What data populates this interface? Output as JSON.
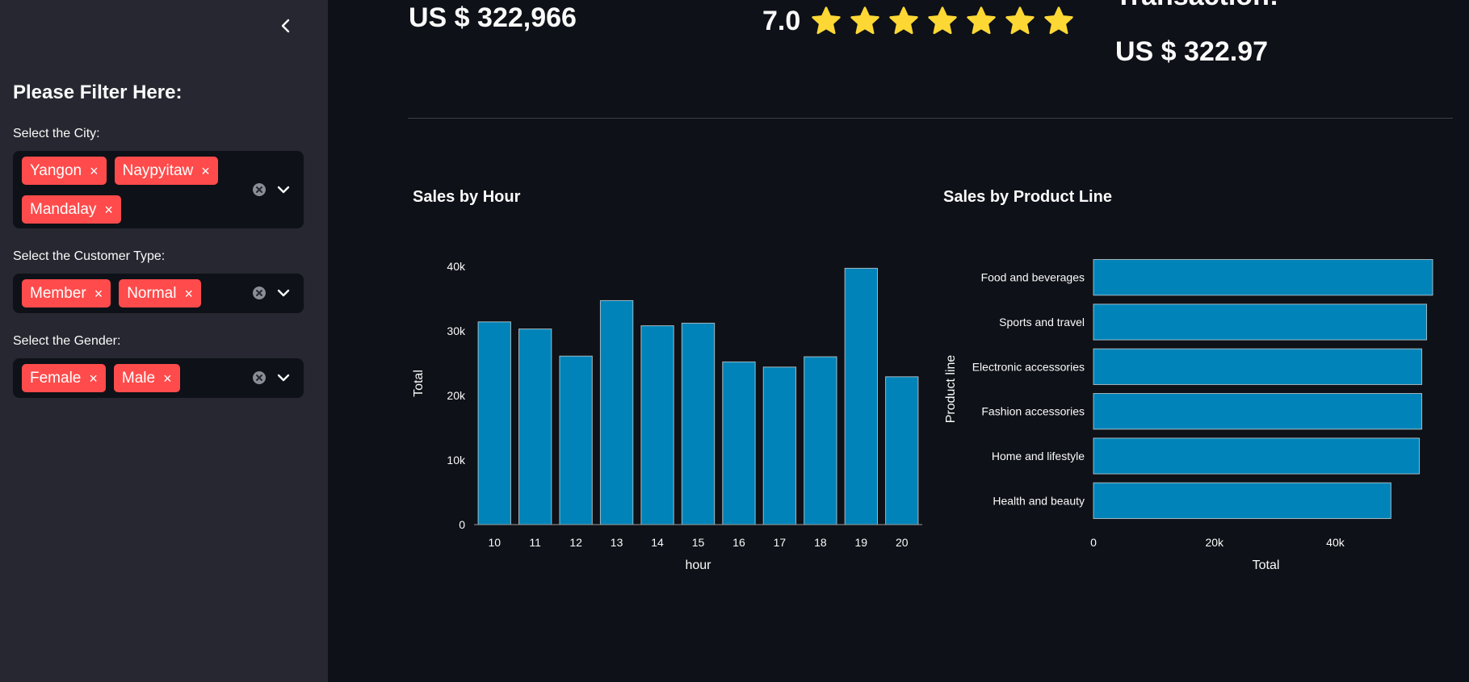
{
  "sidebar": {
    "title": "Please Filter Here:",
    "filters": [
      {
        "label": "Select the City:",
        "tags": [
          "Yangon",
          "Naypyitaw",
          "Mandalay"
        ]
      },
      {
        "label": "Select the Customer Type:",
        "tags": [
          "Member",
          "Normal"
        ]
      },
      {
        "label": "Select the Gender:",
        "tags": [
          "Female",
          "Male"
        ]
      }
    ],
    "tag_close_glyph": "×"
  },
  "kpis": {
    "total_sales": "US $ 322,966",
    "rating": "7.0",
    "rating_stars": 7,
    "avg_transaction_heading": "Transaction:",
    "avg_transaction": "US $ 322.97"
  },
  "colors": {
    "bar": "#0083b8",
    "tag": "#ff4b4b",
    "star": "#fdd835",
    "sidebar_bg": "#262730",
    "main_bg": "#0e1117"
  },
  "chart_data": [
    {
      "type": "bar",
      "title": "Sales by Hour",
      "xlabel": "hour",
      "ylabel": "Total",
      "categories": [
        "10",
        "11",
        "12",
        "13",
        "14",
        "15",
        "16",
        "17",
        "18",
        "19",
        "20"
      ],
      "values": [
        31400,
        30300,
        26100,
        34700,
        30800,
        31200,
        25200,
        24400,
        26000,
        39700,
        22900
      ],
      "ylim": [
        0,
        41000
      ],
      "yticks": [
        0,
        10000,
        20000,
        30000,
        40000
      ],
      "ytick_labels": [
        "0",
        "10k",
        "20k",
        "30k",
        "40k"
      ],
      "grid": false
    },
    {
      "type": "bar",
      "orientation": "horizontal",
      "title": "Sales by Product Line",
      "xlabel": "Total",
      "ylabel": "Product line",
      "categories": [
        "Food and beverages",
        "Sports and travel",
        "Electronic accessories",
        "Fashion accessories",
        "Home and lifestyle",
        "Health and beauty"
      ],
      "values": [
        56100,
        55100,
        54300,
        54300,
        53900,
        49200
      ],
      "xlim": [
        0,
        56500
      ],
      "xticks": [
        0,
        20000,
        40000
      ],
      "xtick_labels": [
        "0",
        "20k",
        "40k"
      ],
      "grid": false
    }
  ]
}
